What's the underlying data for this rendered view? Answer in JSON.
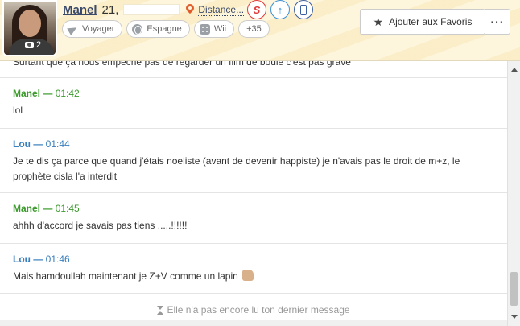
{
  "profile": {
    "name": "Manel",
    "age": "21,",
    "distance_label": "Distance...",
    "photo_count": "2"
  },
  "tags": [
    {
      "label": "Voyager",
      "icon": "plane-icon"
    },
    {
      "label": "Espagne",
      "icon": "globe-icon"
    },
    {
      "label": "Wii",
      "icon": "dice-icon"
    },
    {
      "label": "+35"
    }
  ],
  "actions": {
    "favorite_label": "Ajouter aux Favoris",
    "menu_label": "···",
    "s_label": "S",
    "up_label": "↑"
  },
  "conversation": {
    "partial_message": "Surtant que ça nous empêche pas de regarder un film de boule c'est pas grave",
    "messages": [
      {
        "author": "Manel",
        "time": "01:42",
        "text": "lol",
        "color": "#3a9a2a"
      },
      {
        "author": "Lou",
        "time": "01:44",
        "text": "Je te dis ça parce que quand j'étais noeliste (avant de devenir happiste) je n'avais pas le droit de m+z, le prophète cisla l'a interdit",
        "color": "#3a7fbe"
      },
      {
        "author": "Manel",
        "time": "01:45",
        "text": "ahhh d'accord je savais pas tiens .....!!!!!!",
        "color": "#3a9a2a"
      },
      {
        "author": "Lou",
        "time": "01:46",
        "text": "Mais hamdoullah maintenant je Z+V comme un lapin",
        "color": "#3a7fbe"
      }
    ],
    "read_status": "Elle n'a pas encore lu ton dernier message"
  }
}
